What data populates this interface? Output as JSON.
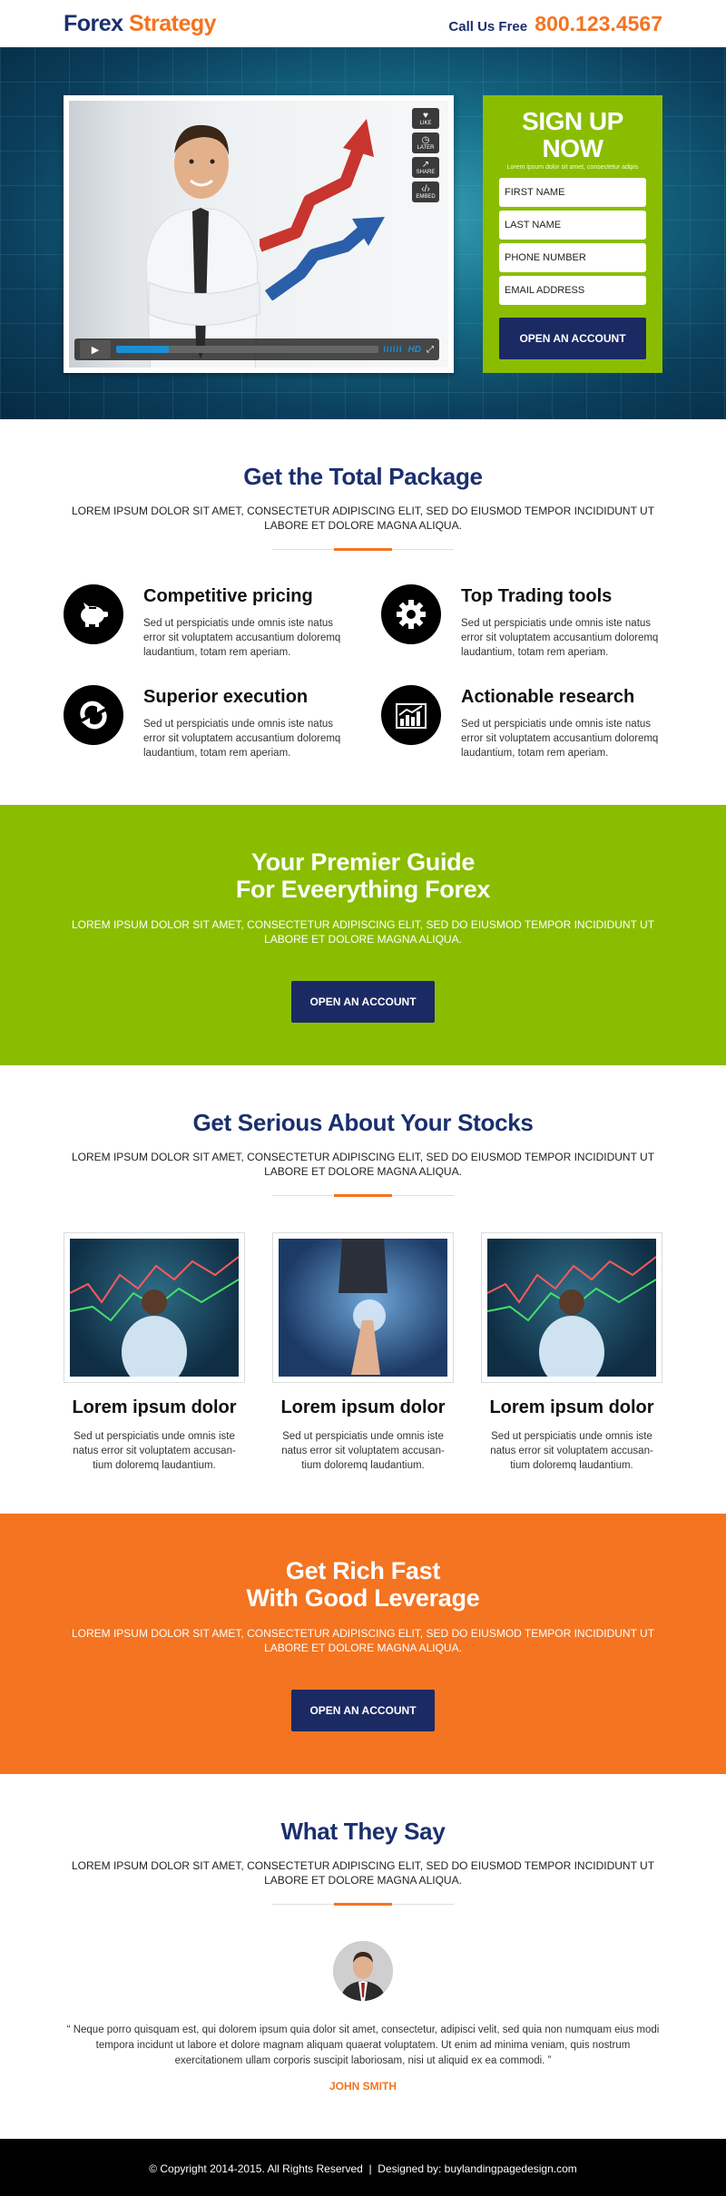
{
  "header": {
    "logo_part1": "Forex",
    "logo_part2": "Strategy",
    "call_label": "Call Us Free",
    "phone": "800.123.4567"
  },
  "video": {
    "side_buttons": [
      {
        "icon": "heart-icon",
        "label": "LIKE"
      },
      {
        "icon": "clock-icon",
        "label": "LATER"
      },
      {
        "icon": "share-icon",
        "label": "SHARE"
      },
      {
        "icon": "embed-icon",
        "label": "EMBED"
      }
    ],
    "hd_label": "HD",
    "volume_label": "IIIIII",
    "progress": 0.2
  },
  "signup": {
    "title": "SIGN UP NOW",
    "subtitle": "Lorem ipsum dolor sit amet, consectetur adipis",
    "fields": [
      "FIRST NAME",
      "LAST NAME",
      "PHONE NUMBER",
      "EMAIL ADDRESS"
    ],
    "button": "OPEN AN ACCOUNT"
  },
  "package": {
    "title": "Get the Total Package",
    "subtitle": "LOREM IPSUM DOLOR SIT AMET, CONSECTETUR ADIPISCING ELIT, SED DO EIUSMOD TEMPOR INCIDIDUNT UT LABORE ET DOLORE MAGNA ALIQUA.",
    "features": [
      {
        "icon": "piggy-bank-icon",
        "title": "Competitive pricing",
        "text": "Sed ut perspiciatis unde omnis iste natus error sit voluptatem accusantium doloremq laudantium, totam rem aperiam."
      },
      {
        "icon": "gear-icon",
        "title": "Top Trading tools",
        "text": "Sed ut perspiciatis unde omnis iste natus error sit voluptatem accusantium doloremq laudantium, totam rem aperiam."
      },
      {
        "icon": "refresh-icon",
        "title": "Superior execution",
        "text": "Sed ut perspiciatis unde omnis iste natus error sit voluptatem accusantium doloremq laudantium, totam rem aperiam."
      },
      {
        "icon": "chart-icon",
        "title": "Actionable research",
        "text": "Sed ut perspiciatis unde omnis iste natus error sit voluptatem accusantium doloremq laudantium, totam rem aperiam."
      }
    ]
  },
  "guide": {
    "title_line1": "Your Premier Guide",
    "title_line2": "For Eveerything Forex",
    "subtitle": "LOREM IPSUM DOLOR SIT AMET, CONSECTETUR ADIPISCING ELIT, SED DO EIUSMOD TEMPOR INCIDIDUNT UT LABORE ET DOLORE MAGNA ALIQUA.",
    "button": "OPEN AN ACCOUNT"
  },
  "stocks": {
    "title": "Get Serious About Your Stocks",
    "subtitle": "LOREM IPSUM DOLOR SIT AMET, CONSECTETUR ADIPISCING ELIT, SED DO EIUSMOD TEMPOR INCIDIDUNT UT LABORE ET DOLORE MAGNA ALIQUA.",
    "cards": [
      {
        "title": "Lorem ipsum dolor",
        "text": "Sed ut perspiciatis unde omnis iste natus error sit voluptatem accusan- tium doloremq laudantium."
      },
      {
        "title": "Lorem ipsum dolor",
        "text": "Sed ut perspiciatis unde omnis iste natus error sit voluptatem accusan- tium doloremq laudantium."
      },
      {
        "title": "Lorem ipsum dolor",
        "text": "Sed ut perspiciatis unde omnis iste natus error sit voluptatem accusan- tium doloremq laudantium."
      }
    ]
  },
  "rich": {
    "title_line1": "Get Rich Fast",
    "title_line2": "With Good Leverage",
    "subtitle": "LOREM IPSUM DOLOR SIT AMET, CONSECTETUR ADIPISCING ELIT, SED DO EIUSMOD TEMPOR INCIDIDUNT UT LABORE ET DOLORE MAGNA ALIQUA.",
    "button": "OPEN AN ACCOUNT"
  },
  "testimonial": {
    "title": "What They Say",
    "subtitle": "LOREM IPSUM DOLOR SIT AMET, CONSECTETUR ADIPISCING ELIT, SED DO EIUSMOD TEMPOR INCIDIDUNT UT LABORE ET DOLORE MAGNA ALIQUA.",
    "quote": "“ Neque porro quisquam est, qui dolorem ipsum quia dolor sit amet, consectetur, adipisci velit, sed quia non numquam eius modi tempora incidunt ut labore et dolore magnam aliquam quaerat voluptatem. Ut enim ad minima veniam, quis nostrum exercitationem ullam corporis suscipit laboriosam, nisi ut aliquid ex ea commodi. ”",
    "author": "JOHN SMITH"
  },
  "footer": {
    "text": "© Copyright 2014-2015. All Rights Reserved  |  Designed by: buylandingpagedesign.com"
  },
  "colors": {
    "navy": "#1b2f6e",
    "orange": "#f47421",
    "green": "#8abd00",
    "button_navy": "#1b2a63"
  }
}
